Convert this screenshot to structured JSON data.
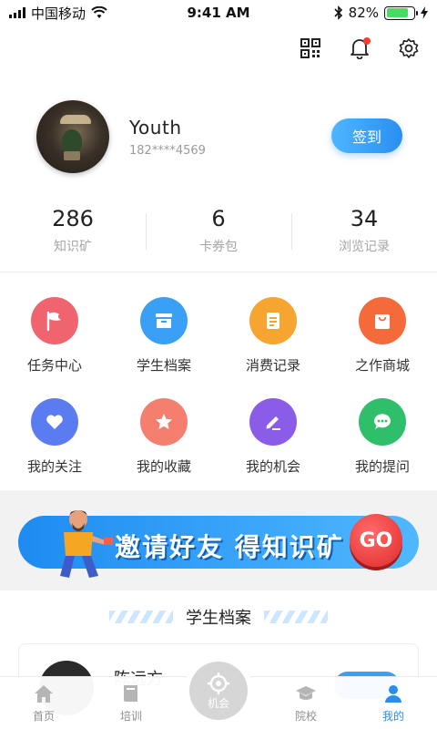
{
  "status_bar": {
    "carrier": "中国移动",
    "time": "9:41 AM",
    "battery": "82%",
    "battery_level": 0.82
  },
  "header": {
    "icons": [
      "qr-code-icon",
      "bell-icon",
      "gear-icon"
    ]
  },
  "profile": {
    "name": "Youth",
    "phone": "182****4569",
    "signin_label": "签到"
  },
  "stats": [
    {
      "value": "286",
      "label": "知识矿"
    },
    {
      "value": "6",
      "label": "卡券包"
    },
    {
      "value": "34",
      "label": "浏览记录"
    }
  ],
  "menu": [
    {
      "label": "任务中心",
      "icon": "flag-icon",
      "color": "#f06470"
    },
    {
      "label": "学生档案",
      "icon": "inbox-icon",
      "color": "#3aa0f5"
    },
    {
      "label": "消费记录",
      "icon": "clipboard-icon",
      "color": "#f7a531"
    },
    {
      "label": "之作商城",
      "icon": "shopping-bag-icon",
      "color": "#f56a3a"
    },
    {
      "label": "我的关注",
      "icon": "heart-icon",
      "color": "#5b7cf0"
    },
    {
      "label": "我的收藏",
      "icon": "star-icon",
      "color": "#f47f6e"
    },
    {
      "label": "我的机会",
      "icon": "edit-icon",
      "color": "#8a5ce8"
    },
    {
      "label": "我的提问",
      "icon": "chat-icon",
      "color": "#2fbf6a"
    }
  ],
  "banner": {
    "text": "邀请好友  得知识矿",
    "go_label": "GO"
  },
  "section": {
    "title": "学生档案"
  },
  "student_card": {
    "name": "陈远方"
  },
  "tabs": [
    {
      "label": "首页",
      "icon": "home-icon",
      "active": false
    },
    {
      "label": "培训",
      "icon": "book-icon",
      "active": false
    },
    {
      "label": "机会",
      "icon": "target-icon",
      "active": false
    },
    {
      "label": "院校",
      "icon": "graduation-cap-icon",
      "active": false
    },
    {
      "label": "我的",
      "icon": "user-icon",
      "active": true
    }
  ],
  "colors": {
    "accent": "#2a8ef0",
    "notification_dot": "#ff3b30"
  }
}
